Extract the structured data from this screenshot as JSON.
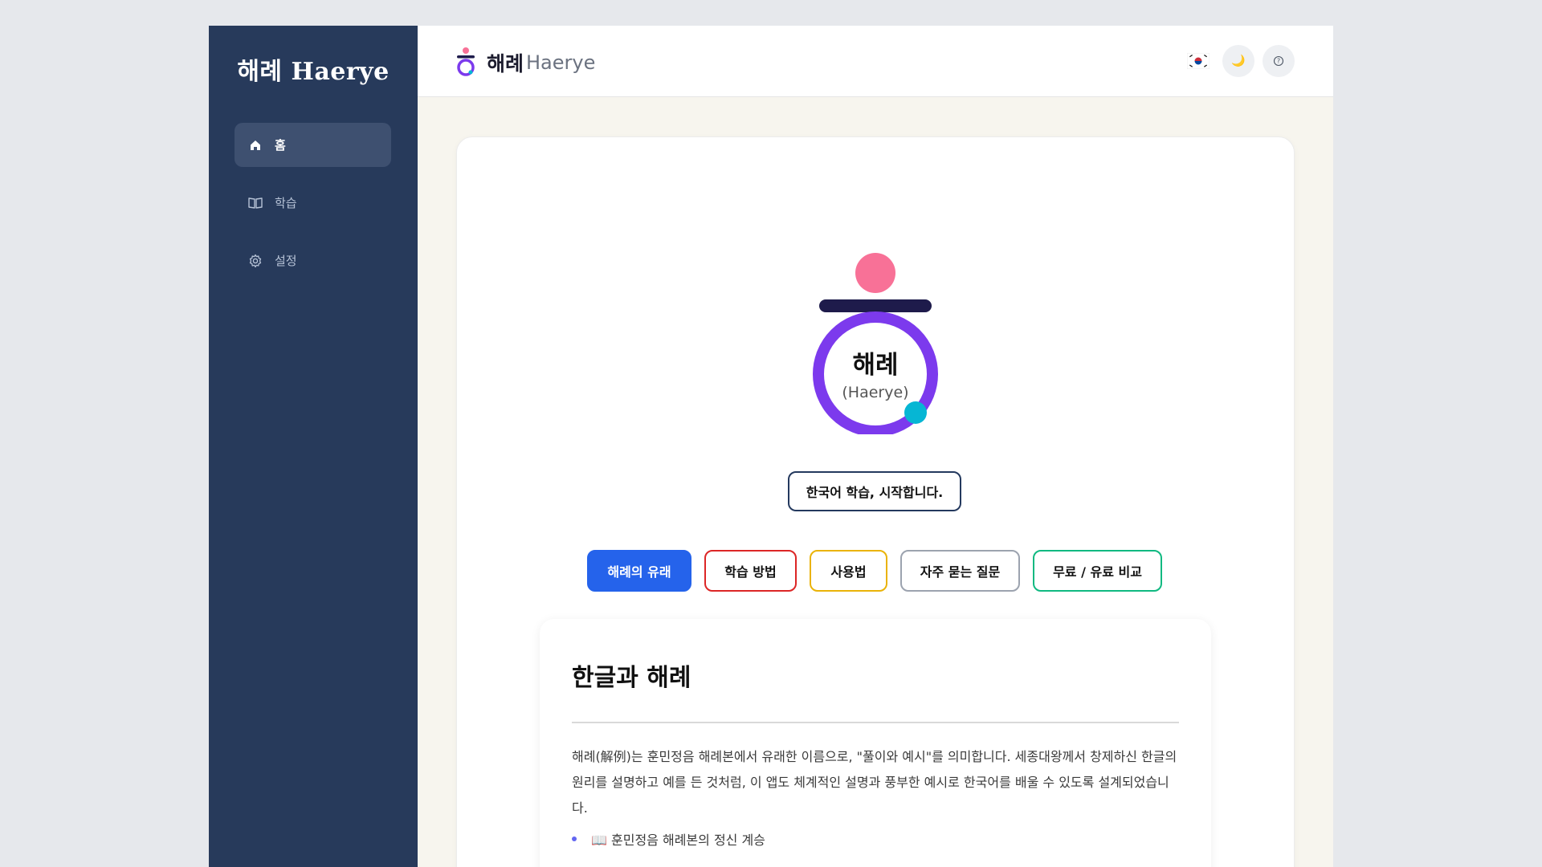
{
  "sidebar": {
    "brand": "해례 Haerye",
    "items": [
      {
        "label": "홈",
        "icon": "home-icon",
        "active": true
      },
      {
        "label": "학습",
        "icon": "book-icon",
        "active": false
      },
      {
        "label": "설정",
        "icon": "gear-icon",
        "active": false
      }
    ]
  },
  "header": {
    "title": "해례",
    "subtitle": "Haerye",
    "actions": [
      {
        "icon": "korean-flag-icon",
        "glyph": "🇰🇷"
      },
      {
        "icon": "moon-icon",
        "glyph": "🌙"
      },
      {
        "icon": "help-icon",
        "glyph": "?"
      }
    ]
  },
  "hero": {
    "logo_text": "해례",
    "logo_sub": "(Haerye)",
    "tagline": "한국어 학습, 시작합니다.",
    "colors": {
      "pink": "#f87197",
      "navy": "#1e1b4b",
      "purple": "#7c3aed",
      "cyan": "#06b6d4"
    }
  },
  "tabs": [
    {
      "label": "해례의 유래",
      "active": true
    },
    {
      "label": "학습 방법",
      "active": false
    },
    {
      "label": "사용법",
      "active": false
    },
    {
      "label": "자주 묻는 질문",
      "active": false
    },
    {
      "label": "무료 / 유료 비교",
      "active": false
    }
  ],
  "content": {
    "heading": "한글과 해례",
    "paragraph": "해례(解例)는 훈민정음 해례본에서 유래한 이름으로, \"풀이와 예시\"를 의미합니다. 세종대왕께서 창제하신 한글의 원리를 설명하고 예를 든 것처럼, 이 앱도 체계적인 설명과 풍부한 예시로 한국어를 배울 수 있도록 설계되었습니다.",
    "bullets": [
      "📖 훈민정음 해례본의 정신 계승"
    ]
  },
  "colors": {
    "sidebar_bg": "#273a5b",
    "accent": "#2563eb",
    "background": "#f7f5ee"
  }
}
